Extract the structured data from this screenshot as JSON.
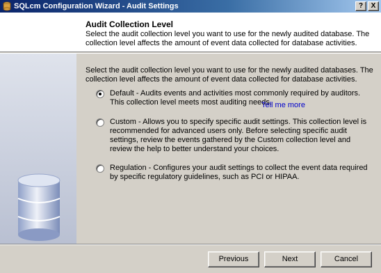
{
  "window": {
    "title": "SQLcm Configuration Wizard - Audit Settings",
    "help_label": "?",
    "close_label": "X"
  },
  "header": {
    "title": "Audit Collection Level",
    "description": "Select the audit collection level you want to use for the newly audited database. The collection level affects the amount of event data collected for database activities."
  },
  "content": {
    "intro": "Select the audit collection level you want to use for the newly audited databases. The collection level affects the amount of event data collected for database activities.",
    "options": [
      {
        "label": "Default - Audits events and activities most commonly required by auditors. This collection level meets most auditing needs.",
        "selected": true,
        "link": "Tell me more"
      },
      {
        "label": "Custom - Allows you to specify specific audit settings. This collection level is recommended for advanced users only. Before selecting specific audit settings, review the events gathered by the Custom collection level and review the help to better understand your choices.",
        "selected": false
      },
      {
        "label": "Regulation - Configures your audit settings to collect the event data required by specific regulatory guidelines, such as PCI or HIPAA.",
        "selected": false
      }
    ]
  },
  "footer": {
    "previous_label": "Previous",
    "next_label": "Next",
    "cancel_label": "Cancel"
  }
}
